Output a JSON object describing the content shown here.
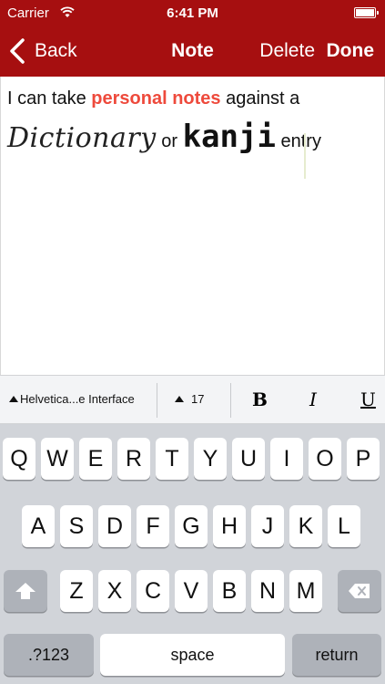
{
  "status": {
    "carrier": "Carrier",
    "time": "6:41 PM"
  },
  "nav": {
    "back": "Back",
    "title": "Note",
    "delete": "Delete",
    "done": "Done"
  },
  "note": {
    "line1_plain": "I can take ",
    "line1_highlight": "personal notes",
    "line1_rest": " against a",
    "word_dictionary": "Dictionary",
    "word_or": " or ",
    "word_kanji": "kanji",
    "word_entry": " entry"
  },
  "format_bar": {
    "font": "Helvetica...e Interface",
    "size": "17",
    "bold": "B",
    "italic": "I",
    "underline": "U"
  },
  "keyboard": {
    "row1": [
      "Q",
      "W",
      "E",
      "R",
      "T",
      "Y",
      "U",
      "I",
      "O",
      "P"
    ],
    "row2": [
      "A",
      "S",
      "D",
      "F",
      "G",
      "H",
      "J",
      "K",
      "L"
    ],
    "row3": [
      "Z",
      "X",
      "C",
      "V",
      "B",
      "N",
      "M"
    ],
    "numbers": ".?123",
    "space": "space",
    "return": "return"
  },
  "colors": {
    "nav_bar": "#a60f10",
    "highlight": "#ee4a3c"
  }
}
